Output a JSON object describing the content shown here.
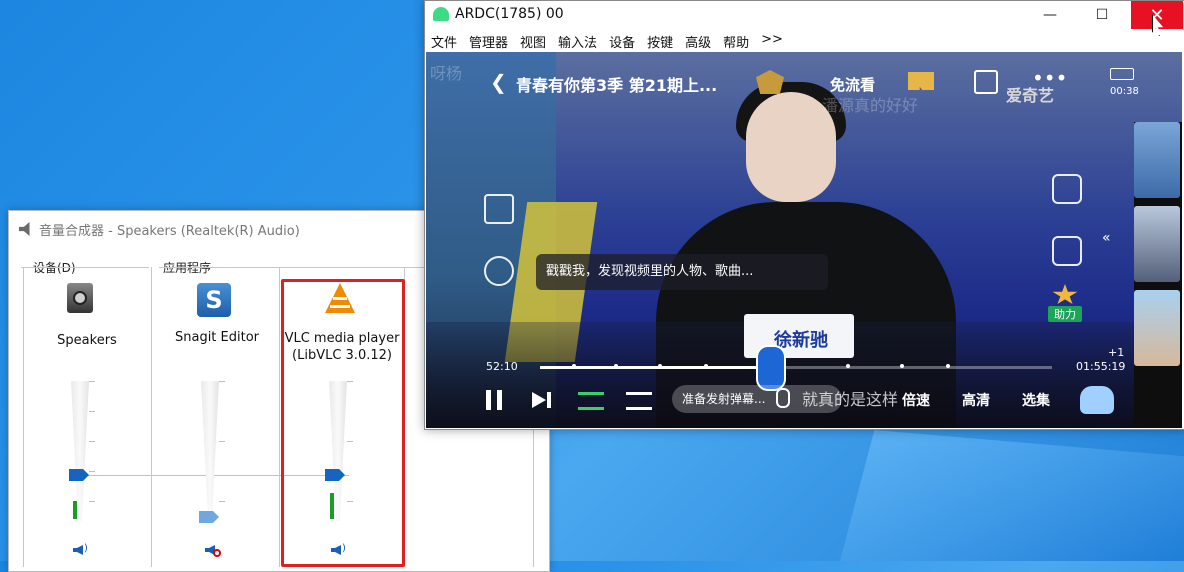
{
  "mixer": {
    "title": "音量合成器 - Speakers (Realtek(R) Audio)",
    "device_section": "设备(D)",
    "apps_section": "应用程序",
    "channels": [
      {
        "name": "Speakers",
        "level": 0.15,
        "muted": false
      },
      {
        "name": "Snagit Editor",
        "level": 0.0,
        "muted": true
      },
      {
        "name": "VLC media player (LibVLC 3.0.12)",
        "name_line1": "VLC media player",
        "name_line2": "(LibVLC 3.0.12)",
        "level": 0.15,
        "muted": false
      }
    ]
  },
  "ardc": {
    "title": "ARDC(1785) 00",
    "window_buttons": {
      "minimize": "—",
      "maximize": "☐",
      "close": "✕"
    },
    "menu": [
      "文件",
      "管理器",
      "视图",
      "输入法",
      "设备",
      "按键",
      "高级",
      "帮助",
      ">>"
    ]
  },
  "video": {
    "back": "❮",
    "title": "青春有你第3季 第21期上...",
    "free_watch": "免流看",
    "brand": "爱奇艺",
    "clock": "00:38",
    "caption_ghost": "潘源真的好好",
    "caption_top_ghost": "呀杨",
    "bubble_text": "戳戳我，发现视频里的人物、歌曲...",
    "namecard": "徐新驰",
    "time_current": "52:10",
    "time_total": "01:55:19",
    "progress": 0.45,
    "danmu_placeholder": "准备发射弹幕...",
    "bottom_ghost": "就真的是这样",
    "speed": "倍速",
    "quality": "高清",
    "episodes": "选集",
    "boost": "助力",
    "plus_one": "+1"
  }
}
